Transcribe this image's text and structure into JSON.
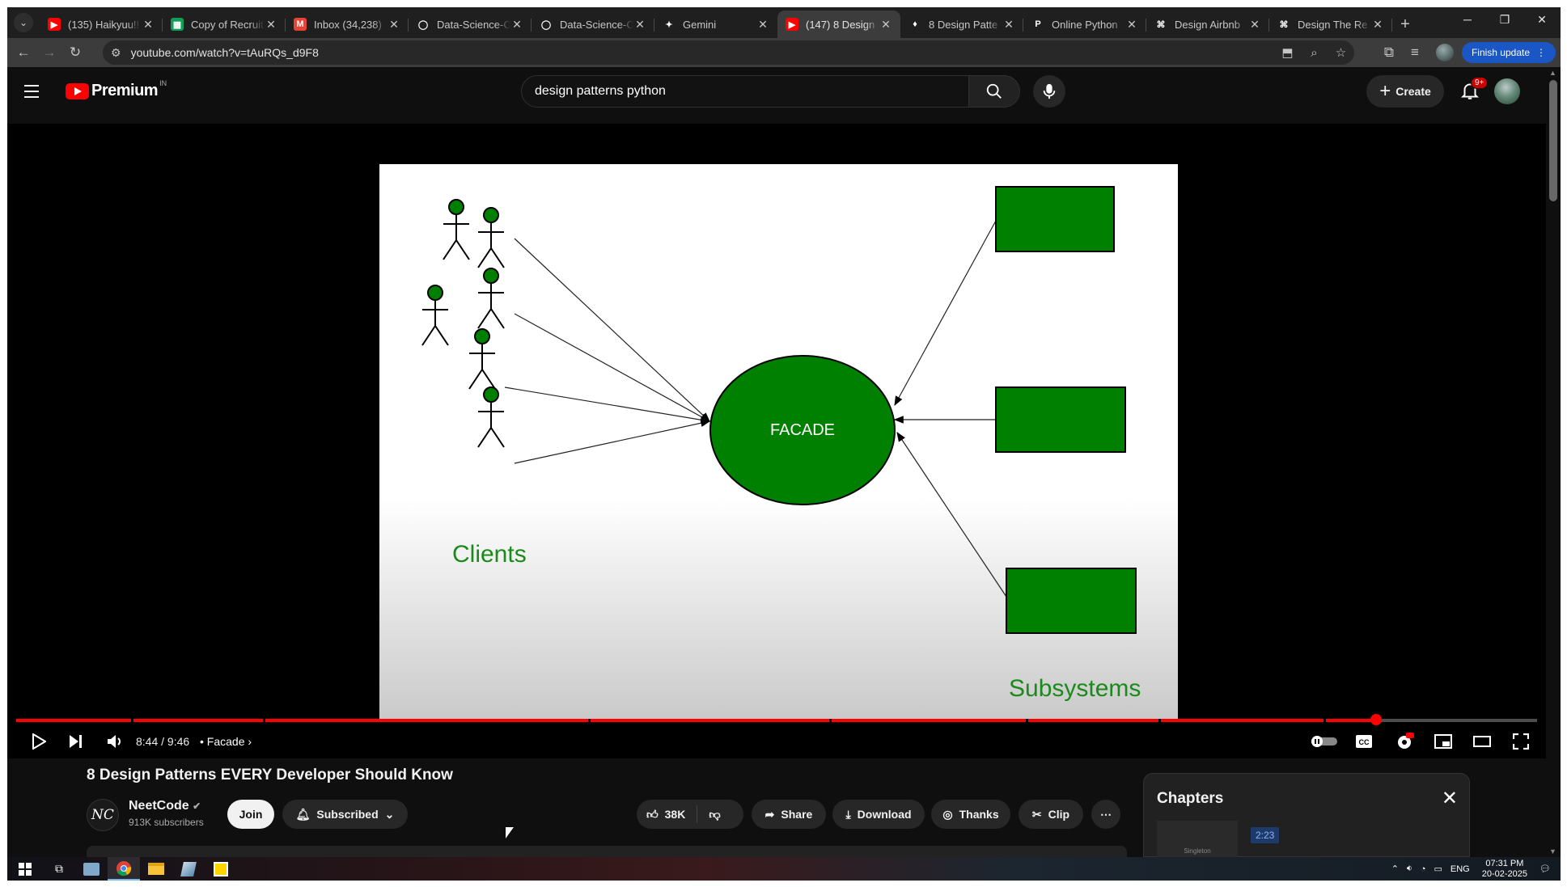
{
  "browser": {
    "tabs": [
      {
        "title": "(135) Haikyuu!!",
        "fav_color": "#ff0000",
        "fav_glyph": "▶"
      },
      {
        "title": "Copy of Recruit",
        "fav_color": "#0f9d58",
        "fav_glyph": "▦"
      },
      {
        "title": "Inbox (34,238)",
        "fav_color": "#ea4335",
        "fav_glyph": "M"
      },
      {
        "title": "Data-Science-C",
        "fav_color": "#1f1f1f",
        "fav_glyph": "◯"
      },
      {
        "title": "Data-Science-C",
        "fav_color": "#1f1f1f",
        "fav_glyph": "◯"
      },
      {
        "title": "Gemini",
        "fav_color": "#1f1f1f",
        "fav_glyph": "✦"
      },
      {
        "title": "(147) 8 Design",
        "fav_color": "#ff0000",
        "fav_glyph": "▶"
      },
      {
        "title": "8 Design Patte",
        "fav_color": "#1f1f1f",
        "fav_glyph": "♦"
      },
      {
        "title": "Online Python",
        "fav_color": "#1f1f1f",
        "fav_glyph": "P"
      },
      {
        "title": "Design Airbnb",
        "fav_color": "#1f1f1f",
        "fav_glyph": "⌘"
      },
      {
        "title": "Design The Re",
        "fav_color": "#1f1f1f",
        "fav_glyph": "⌘"
      }
    ],
    "url": "youtube.com/watch?v=tAuRQs_d9F8",
    "finish_update_label": "Finish update"
  },
  "youtube": {
    "logo_text": "Premium",
    "country_code": "IN",
    "search_query": "design patterns python",
    "create_label": "Create",
    "notif_badge": "9+"
  },
  "slide": {
    "facade_label": "FACADE",
    "clients_label": "Clients",
    "subsystems_label": "Subsystems",
    "green": "#008000"
  },
  "player": {
    "time": "8:44 / 9:46",
    "chapter": "Facade",
    "progress_fraction": 0.894
  },
  "video": {
    "title": "8 Design Patterns EVERY Developer Should Know",
    "channel_logo_text": "NC",
    "channel": "NeetCode",
    "subscribers": "913K subscribers",
    "join_label": "Join",
    "subscribed_label": "Subscribed",
    "likes": "38K",
    "share_label": "Share",
    "download_label": "Download",
    "thanks_label": "Thanks",
    "clip_label": "Clip"
  },
  "chapters_panel": {
    "heading": "Chapters",
    "thumb_caption": "Singleton",
    "timestamp": "2:23"
  },
  "taskbar": {
    "lang": "ENG",
    "time": "07:31 PM",
    "date": "20-02-2025"
  }
}
